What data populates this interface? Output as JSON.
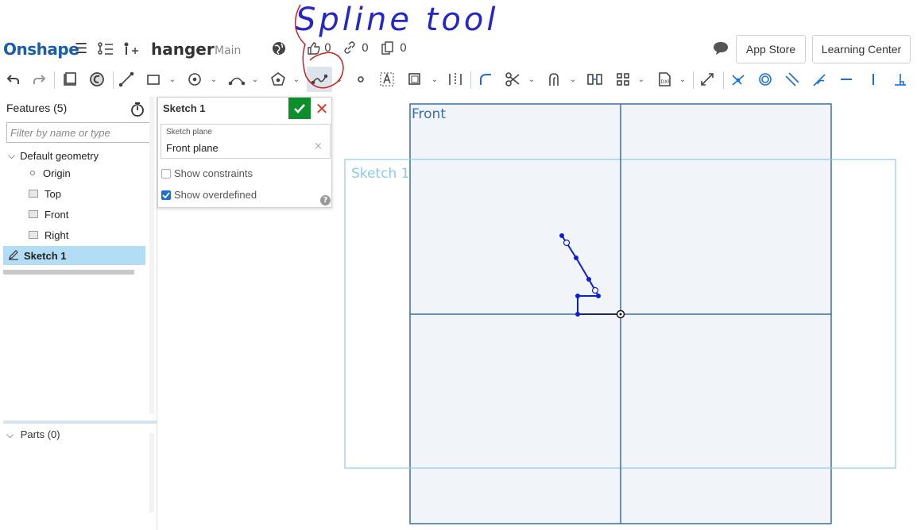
{
  "annotation": {
    "text": "Spline tool",
    "color": "#2525c8",
    "circle_color": "#d01c1c"
  },
  "topbar": {
    "logo": "Onshape",
    "document_name": "hanger",
    "branch": "Main",
    "likes": "0",
    "links": "0",
    "copies": "0",
    "app_store_label": "App Store",
    "learning_center_label": "Learning Center"
  },
  "toolbar": {
    "tools": [
      "undo-icon",
      "redo-icon",
      "new-sketch-icon",
      "use-icon",
      "line-icon",
      "rectangle-icon",
      "circle-icon",
      "arc-icon",
      "polygon-icon",
      "spline-icon",
      "point-icon",
      "text-icon",
      "offset-icon",
      "mirror-icon",
      "fillet-icon",
      "trim-icon",
      "extend-icon",
      "dimension-icon",
      "pattern-icon",
      "dxf-icon",
      "transform-icon",
      "coincident-icon",
      "concentric-icon",
      "parallel-icon",
      "tangent-icon",
      "horizontal-icon",
      "vertical-icon",
      "perpendicular-icon"
    ]
  },
  "features": {
    "title": "Features (5)",
    "filter_placeholder": "Filter by name or type",
    "default_geometry": "Default geometry",
    "items": [
      {
        "label": "Origin"
      },
      {
        "label": "Top"
      },
      {
        "label": "Front"
      },
      {
        "label": "Right"
      }
    ],
    "sketch": "Sketch 1"
  },
  "parts": {
    "title": "Parts (0)"
  },
  "sketch_dialog": {
    "title": "Sketch 1",
    "plane_label": "Sketch plane",
    "plane_value": "Front plane",
    "show_constraints_label": "Show constraints",
    "show_constraints": false,
    "show_overdefined_label": "Show overdefined",
    "show_overdefined": true,
    "ok_color": "#0c8f2a",
    "cancel_color": "#d63b2a"
  },
  "viewport": {
    "front_plane_label": "Front",
    "sketch_label": "Sketch 1",
    "plane_color": "#3a6fa8",
    "sketch_color": "#8ecae6",
    "geometry_color": "#0b1fd6"
  }
}
